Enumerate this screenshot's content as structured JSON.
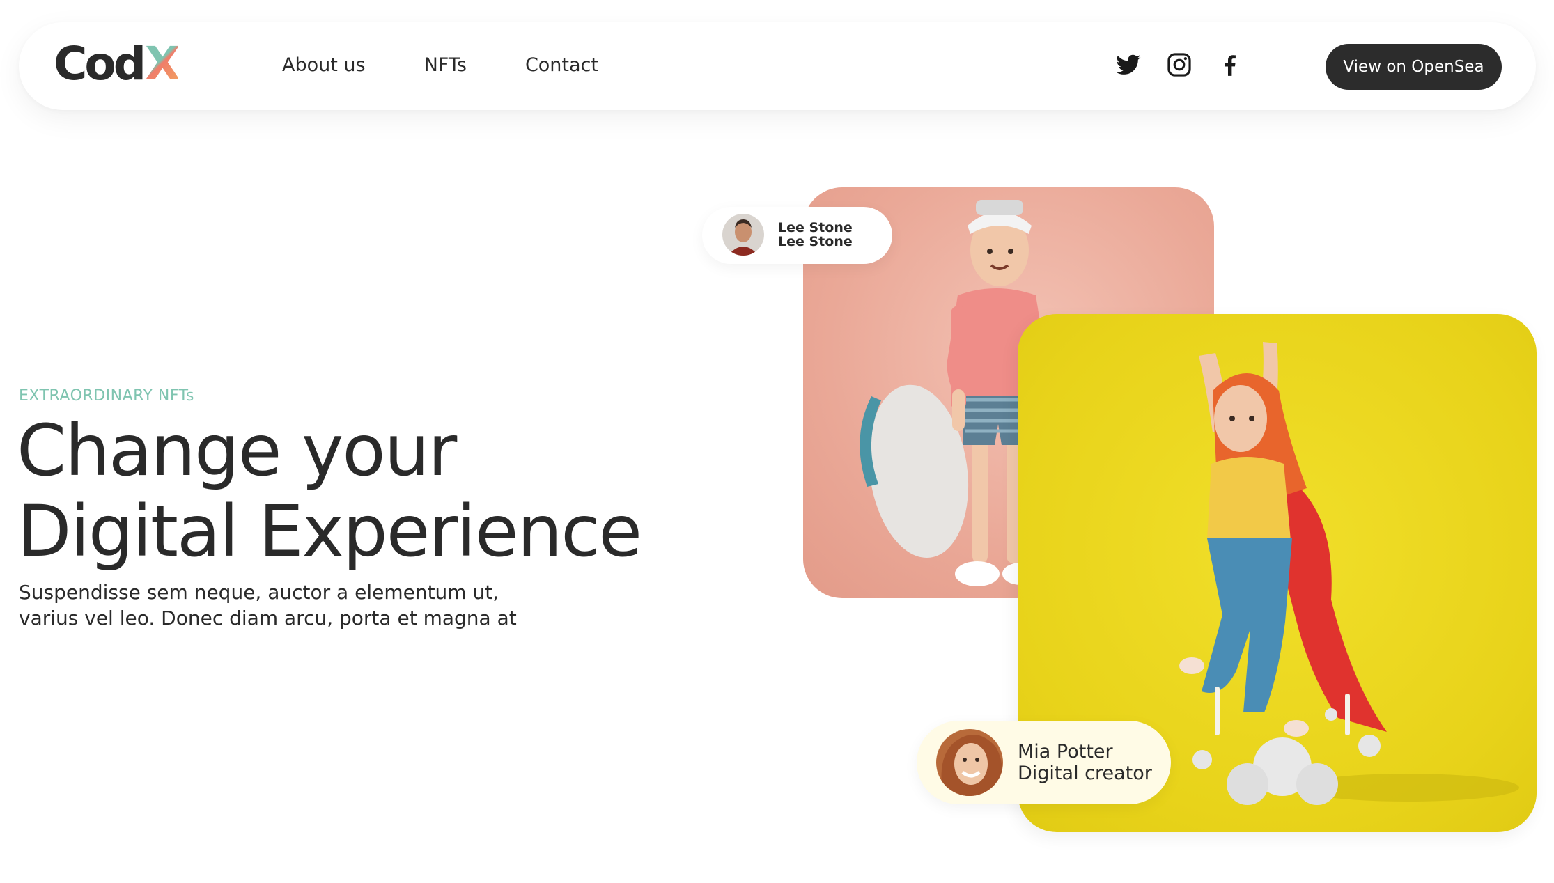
{
  "brand": {
    "logo_main": "Cod",
    "logo_accent": "X"
  },
  "nav": {
    "links": [
      {
        "label": "About us"
      },
      {
        "label": "NFTs"
      },
      {
        "label": "Contact"
      }
    ],
    "social": [
      "twitter-icon",
      "instagram-icon",
      "facebook-icon"
    ],
    "cta_label": "View on OpenSea"
  },
  "hero": {
    "eyebrow": "EXTRAORDINARY NFTs",
    "headline_line1": "Change your",
    "headline_line2": "Digital Experience",
    "sub_line1": "Suspendisse sem neque, auctor a elementum ut,",
    "sub_line2": "varius vel leo. Donec diam arcu, porta et magna at"
  },
  "creators": {
    "first": {
      "line1": "Lee Stone",
      "line2": "Lee Stone"
    },
    "second": {
      "line1": "Mia Potter",
      "line2": "Digital creator"
    }
  },
  "colors": {
    "accent_teal": "#7fc4b0",
    "accent_coral": "#f07d6a",
    "card_pink": "#eaa897",
    "card_yellow": "#e8d31a",
    "button_dark": "#2c2c2c",
    "text_dark": "#2a2a2a"
  }
}
